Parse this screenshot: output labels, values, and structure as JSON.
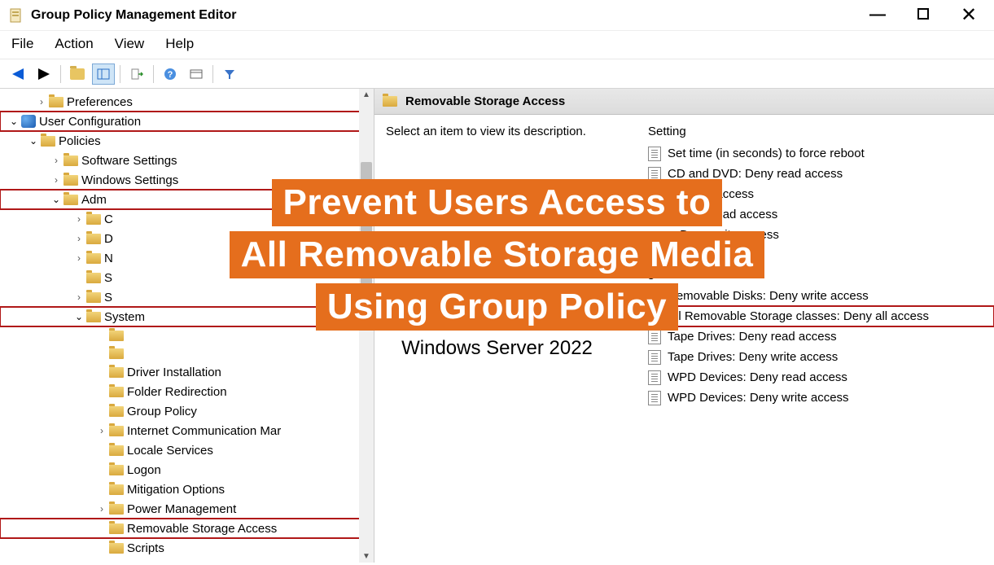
{
  "window": {
    "title": "Group Policy Management Editor"
  },
  "menu": {
    "file": "File",
    "action": "Action",
    "view": "View",
    "help": "Help"
  },
  "tree": {
    "preferences": "Preferences",
    "user_config": "User Configuration",
    "policies": "Policies",
    "software_settings": "Software Settings",
    "windows_settings": "Windows Settings",
    "admin": "Adm",
    "c_item": "C",
    "d_item": "D",
    "n_item": "N",
    "s_item1": "S",
    "s_item2": "S",
    "system": "System",
    "driver_inst": "Driver Installation",
    "folder_redir": "Folder Redirection",
    "group_policy": "Group Policy",
    "internet_comm": "Internet Communication Mar",
    "locale_services": "Locale Services",
    "logon": "Logon",
    "mitigation": "Mitigation Options",
    "power_mgmt": "Power Management",
    "removable_storage": "Removable Storage Access",
    "scripts": "Scripts"
  },
  "detail": {
    "header": "Removable Storage Access",
    "desc_prompt": "Select an item to view its description.",
    "col_setting": "Setting",
    "settings": [
      "Set time (in seconds) to force reboot",
      "CD and DVD: Deny read access",
      ": Deny write access",
      "sses: Deny read access",
      "sses: Deny write access",
      "s",
      "s",
      "Removable Disks: Deny write access",
      "All Removable Storage classes: Deny all access",
      "Tape Drives: Deny read access",
      "Tape Drives: Deny write access",
      "WPD Devices: Deny read access",
      "WPD Devices: Deny write access"
    ]
  },
  "overlay": {
    "line1": "Prevent Users Access to",
    "line2": "All Removable Storage Media",
    "line3": "Using Group Policy",
    "subtitle": "Windows Server 2022"
  }
}
